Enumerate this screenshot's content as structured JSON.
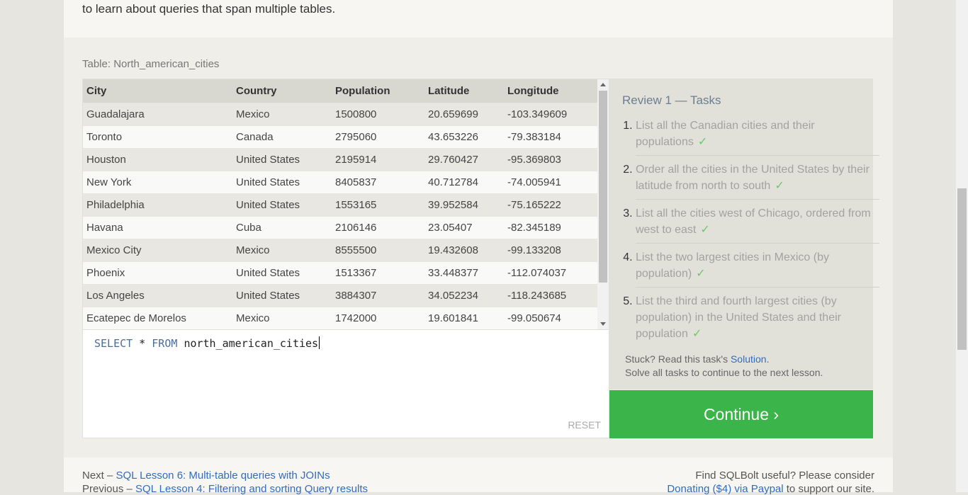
{
  "intro": {
    "text": "different combination of clauses in your query for each task. Once you're done, continue onto the next lesson to learn about queries that span multiple tables."
  },
  "table": {
    "caption": "Table: North_american_cities",
    "columns": [
      "City",
      "Country",
      "Population",
      "Latitude",
      "Longitude"
    ],
    "rows": [
      [
        "Guadalajara",
        "Mexico",
        "1500800",
        "20.659699",
        "-103.349609"
      ],
      [
        "Toronto",
        "Canada",
        "2795060",
        "43.653226",
        "-79.383184"
      ],
      [
        "Houston",
        "United States",
        "2195914",
        "29.760427",
        "-95.369803"
      ],
      [
        "New York",
        "United States",
        "8405837",
        "40.712784",
        "-74.005941"
      ],
      [
        "Philadelphia",
        "United States",
        "1553165",
        "39.952584",
        "-75.165222"
      ],
      [
        "Havana",
        "Cuba",
        "2106146",
        "23.05407",
        "-82.345189"
      ],
      [
        "Mexico City",
        "Mexico",
        "8555500",
        "19.432608",
        "-99.133208"
      ],
      [
        "Phoenix",
        "United States",
        "1513367",
        "33.448377",
        "-112.074037"
      ],
      [
        "Los Angeles",
        "United States",
        "3884307",
        "34.052234",
        "-118.243685"
      ],
      [
        "Ecatepec de Morelos",
        "Mexico",
        "1742000",
        "19.601841",
        "-99.050674"
      ]
    ]
  },
  "editor": {
    "kw_select": "SELECT",
    "star": "*",
    "kw_from": "FROM",
    "table_name": "north_american_cities",
    "reset_label": "RESET"
  },
  "tasks": {
    "title": "Review 1 — Tasks",
    "check_mark": "✓",
    "items": [
      "List all the Canadian cities and their populations",
      "Order all the cities in the United States by their latitude from north to south",
      "List all the cities west of Chicago, ordered from west to east",
      "List the two largest cities in Mexico (by population)",
      "List the third and fourth largest cities (by population) in the United States and their population"
    ],
    "stuck_prefix": "Stuck? Read this task's ",
    "solution_link": "Solution",
    "stuck_suffix": ".",
    "solve_all": "Solve all tasks to continue to the next lesson."
  },
  "continue_label": "Continue ›",
  "footer": {
    "next_prefix": "Next – ",
    "next_link": "SQL Lesson 6: Multi-table queries with JOINs",
    "prev_prefix": "Previous – ",
    "prev_link": "SQL Lesson 4: Filtering and sorting Query results",
    "donate_line1": "Find SQLBolt useful? Please consider",
    "donate_link": "Donating ($4) via Paypal",
    "donate_suffix": " to support our site."
  }
}
